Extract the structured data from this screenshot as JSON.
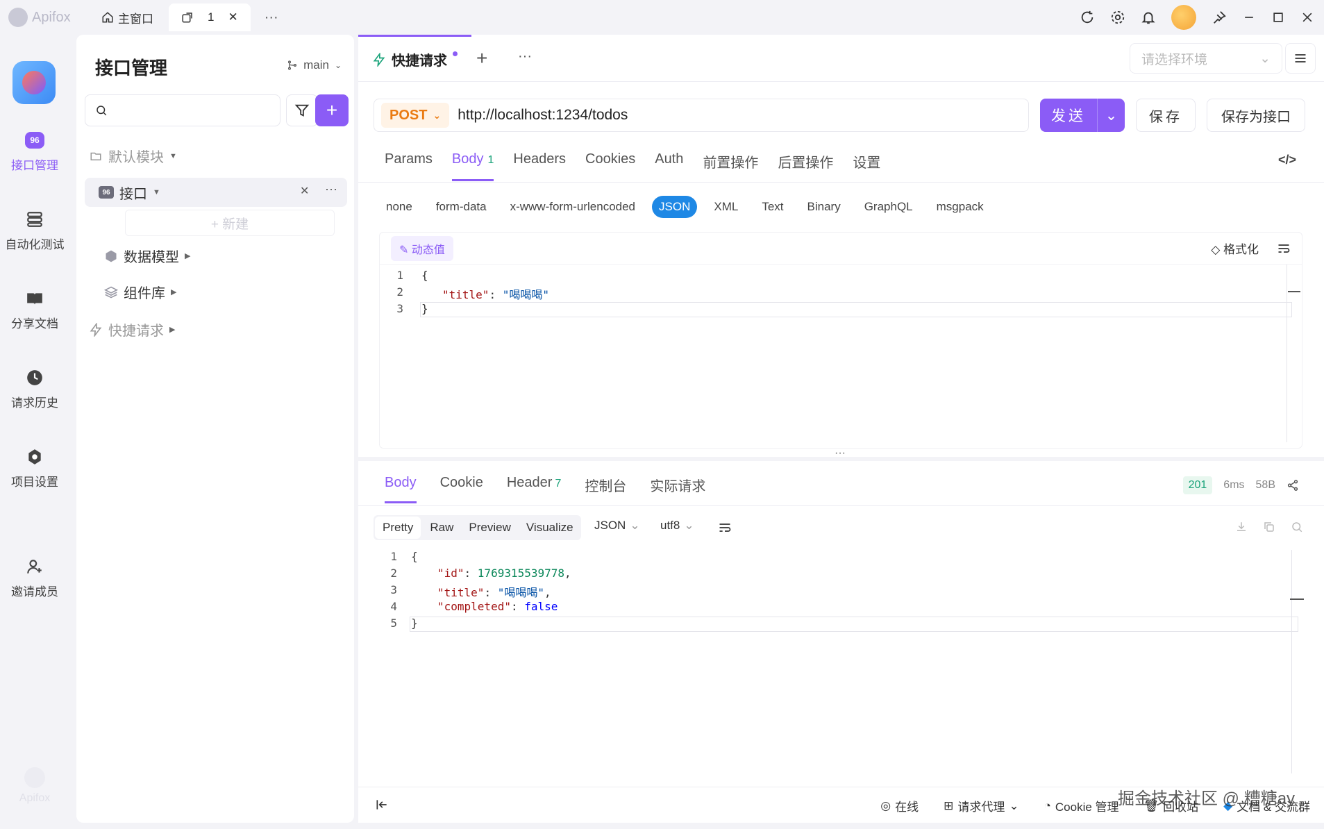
{
  "titlebar": {
    "app_name": "Apifox",
    "home_tab": "主窗口",
    "active_tab": "1",
    "more": "···"
  },
  "rail": {
    "items": [
      {
        "label": "接口管理",
        "icon": "api-icon",
        "active": true
      },
      {
        "label": "自动化测试",
        "icon": "layers-icon"
      },
      {
        "label": "分享文档",
        "icon": "book-icon"
      },
      {
        "label": "请求历史",
        "icon": "clock-icon"
      },
      {
        "label": "项目设置",
        "icon": "gear-icon"
      },
      {
        "label": "邀请成员",
        "icon": "add-user-icon"
      }
    ],
    "bottom_brand": "Apifox"
  },
  "sidebar": {
    "title": "接口管理",
    "branch": "main",
    "search_placeholder": "",
    "tree": {
      "default_module": "默认模块",
      "api": "接口",
      "new": "+ 新建",
      "data_model": "数据模型",
      "components": "组件库",
      "quick_request": "快捷请求"
    }
  },
  "main": {
    "tab_label": "快捷请求",
    "env_placeholder": "请选择环境",
    "request": {
      "method": "POST",
      "url": "http://localhost:1234/todos",
      "send": "发送",
      "save": "保存",
      "save_as_api": "保存为接口"
    },
    "req_tabs": [
      {
        "label": "Params"
      },
      {
        "label": "Body",
        "count": "1",
        "active": true
      },
      {
        "label": "Headers"
      },
      {
        "label": "Cookies"
      },
      {
        "label": "Auth"
      },
      {
        "label": "前置操作"
      },
      {
        "label": "后置操作"
      },
      {
        "label": "设置"
      }
    ],
    "body_types": [
      "none",
      "form-data",
      "x-www-form-urlencoded",
      "JSON",
      "XML",
      "Text",
      "Binary",
      "GraphQL",
      "msgpack"
    ],
    "body_type_selected": "JSON",
    "editor": {
      "dynamic_value": "动态值",
      "format": "格式化",
      "lines": [
        {
          "n": "1",
          "text": "{"
        },
        {
          "n": "2",
          "key": "\"title\"",
          "sep": ": ",
          "val": "\"喝喝喝\""
        },
        {
          "n": "3",
          "text": "}"
        }
      ]
    },
    "response": {
      "tabs": [
        {
          "label": "Body",
          "active": true
        },
        {
          "label": "Cookie"
        },
        {
          "label": "Header",
          "count": "7"
        },
        {
          "label": "控制台"
        },
        {
          "label": "实际请求"
        }
      ],
      "status": "201",
      "time": "6ms",
      "size": "58B",
      "view_tabs": [
        "Pretty",
        "Raw",
        "Preview",
        "Visualize"
      ],
      "view_selected": "Pretty",
      "format": "JSON",
      "encoding": "utf8",
      "lines": [
        {
          "n": "1",
          "text": "{"
        },
        {
          "n": "2",
          "key": "\"id\"",
          "sep": ": ",
          "val": "1769315539778",
          "tail": ","
        },
        {
          "n": "3",
          "key": "\"title\"",
          "sep": ": ",
          "val": "\"喝喝喝\"",
          "tail": ","
        },
        {
          "n": "4",
          "key": "\"completed\"",
          "sep": ": ",
          "val": "false"
        },
        {
          "n": "5",
          "text": "}"
        }
      ]
    },
    "footer": {
      "online": "在线",
      "proxy": "请求代理",
      "cookie": "Cookie 管理",
      "recycle": "回收站",
      "docs": "文档 & 交流群"
    },
    "watermark": "掘金技术社区 @ 糟糖ay"
  }
}
